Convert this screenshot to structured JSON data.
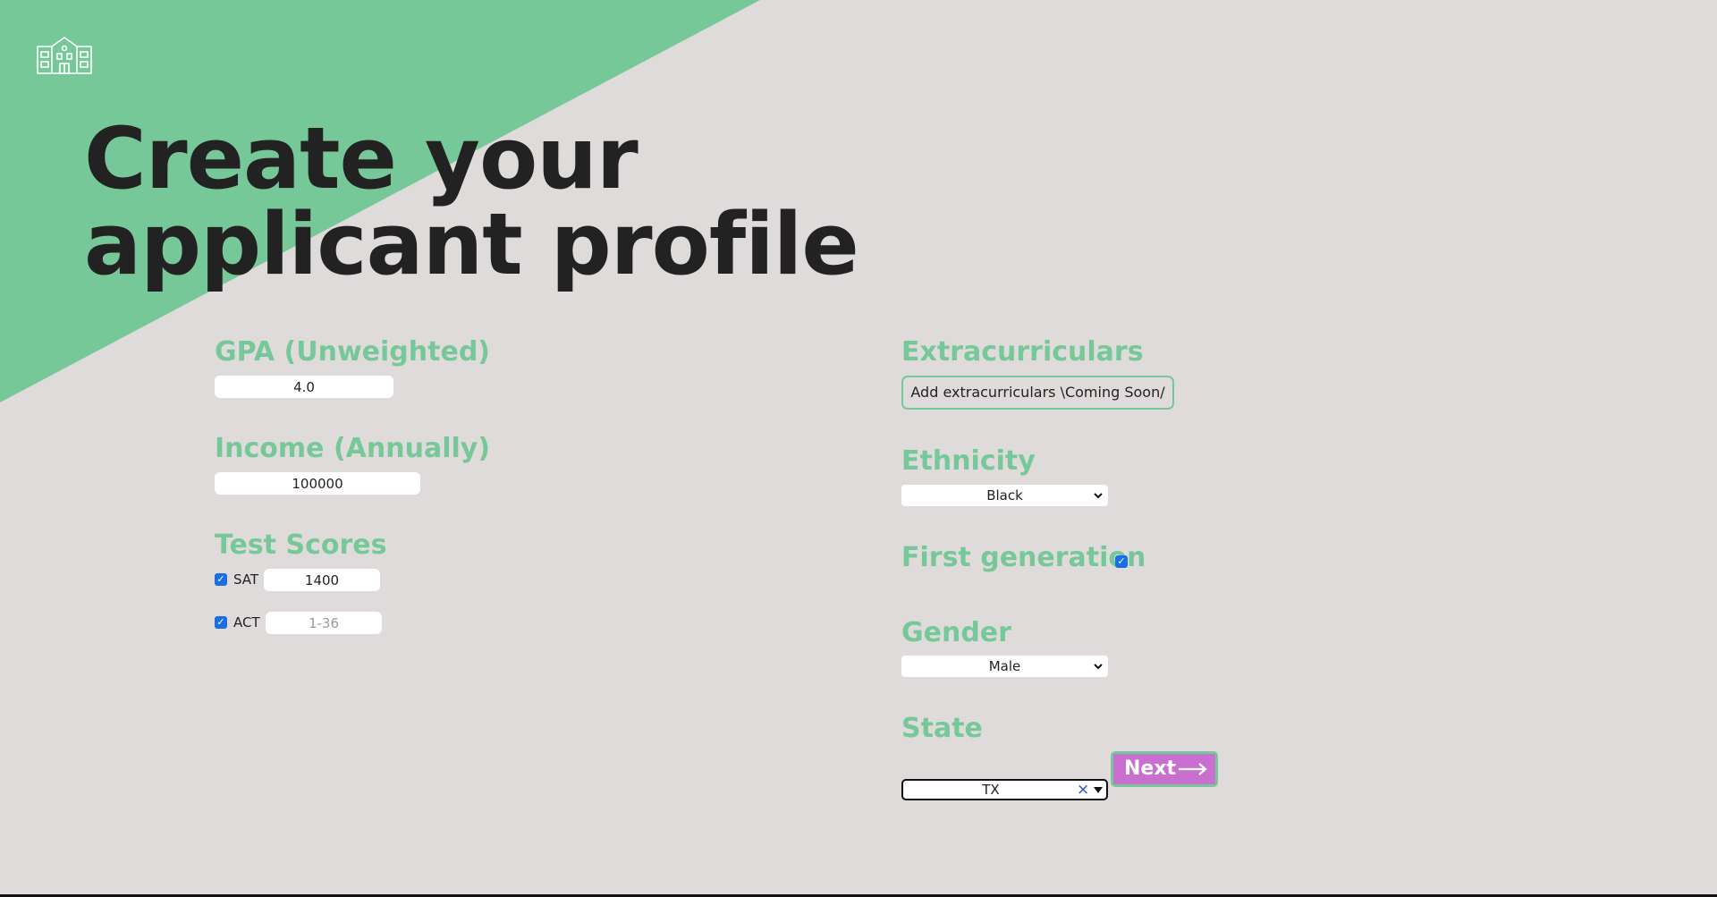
{
  "colors": {
    "background": "#e0dbdb",
    "accent_green": "#77c898",
    "title_text": "#222222",
    "next_button": "#c86fd0",
    "checkbox_blue": "#1a6ee6"
  },
  "header": {
    "logo_icon": "school-building-icon",
    "title_line1": "Create your",
    "title_line2": "applicant profile"
  },
  "left": {
    "gpa": {
      "label": "GPA (Unweighted)",
      "value": "4.0"
    },
    "income": {
      "label": "Income (Annually)",
      "value": "100000"
    },
    "test_scores": {
      "label": "Test Scores",
      "sat": {
        "checked": true,
        "label": "SAT",
        "value": "1400",
        "placeholder": ""
      },
      "act": {
        "checked": true,
        "label": "ACT",
        "value": "",
        "placeholder": "1-36"
      }
    }
  },
  "right": {
    "extracurriculars": {
      "label": "Extracurriculars",
      "button_label": "Add extracurriculars \\Coming Soon/"
    },
    "ethnicity": {
      "label": "Ethnicity",
      "selected": "Black"
    },
    "first_generation": {
      "label": "First generation",
      "checked": true
    },
    "gender": {
      "label": "Gender",
      "selected": "Male"
    },
    "state": {
      "label": "State",
      "selected": "TX"
    }
  },
  "actions": {
    "next_label": "Next"
  }
}
